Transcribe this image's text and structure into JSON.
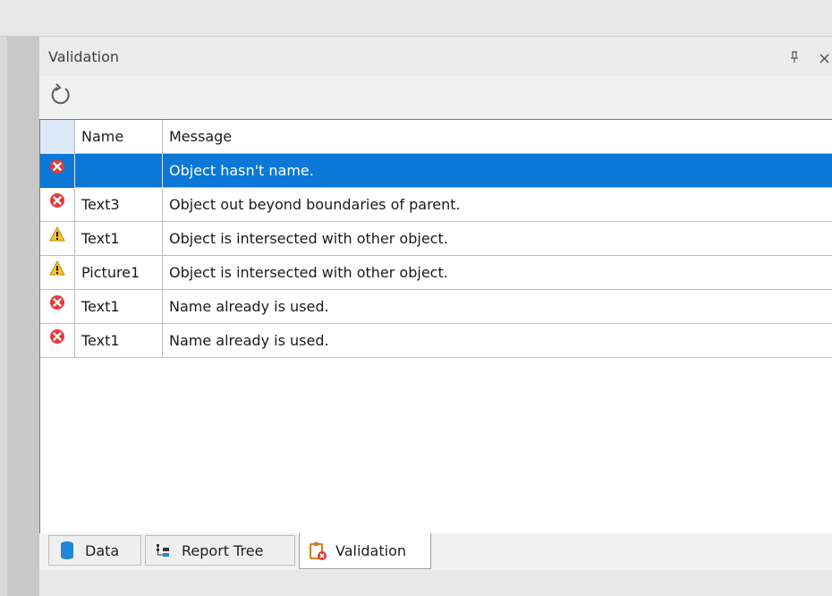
{
  "panel": {
    "title": "Validation",
    "pin_glyph": "ꟷ",
    "close_glyph": "×"
  },
  "grid": {
    "columns": [
      "Name",
      "Message"
    ],
    "rows": [
      {
        "status": "error",
        "name": "",
        "message": "Object hasn't name.",
        "selected": true
      },
      {
        "status": "error",
        "name": "Text3",
        "message": "Object out beyond boundaries of parent.",
        "selected": false
      },
      {
        "status": "warning",
        "name": "Text1",
        "message": "Object is intersected with other object.",
        "selected": false
      },
      {
        "status": "warning",
        "name": "Picture1",
        "message": "Object is intersected with other object.",
        "selected": false
      },
      {
        "status": "error",
        "name": "Text1",
        "message": "Name already is used.",
        "selected": false
      },
      {
        "status": "error",
        "name": "Text1",
        "message": "Name already is used.",
        "selected": false
      }
    ]
  },
  "tabs": [
    {
      "label": "Data",
      "icon": "database-icon",
      "active": false
    },
    {
      "label": "Report Tree",
      "icon": "report-tree-icon",
      "active": false
    },
    {
      "label": "Validation",
      "icon": "validation-icon",
      "active": true
    }
  ],
  "colors": {
    "selection": "#0b78d7",
    "error": "#e33b3b",
    "warning": "#f4c430"
  }
}
